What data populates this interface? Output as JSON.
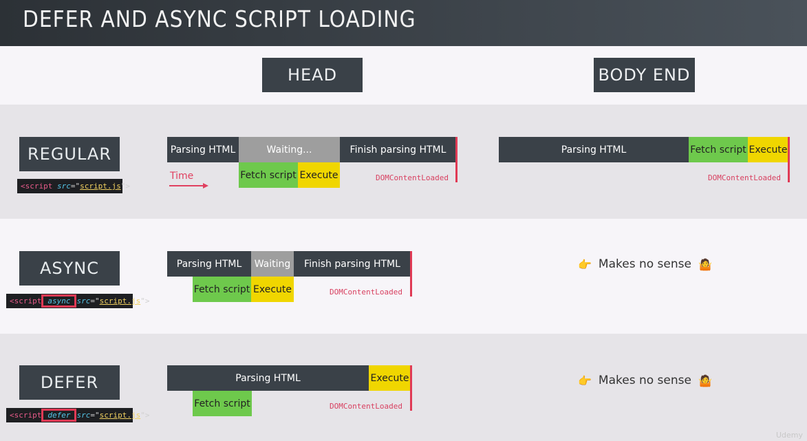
{
  "title": "DEFER AND ASYNC SCRIPT LOADING",
  "columns": {
    "head": "HEAD",
    "body_end": "BODY END"
  },
  "rows": {
    "regular": {
      "label": "REGULAR",
      "code": {
        "open": "<script ",
        "attr": "src",
        "eq": "=\"",
        "file": "script.js",
        "close": "\">"
      },
      "head": {
        "parse": "Parsing HTML",
        "wait": "Waiting...",
        "finish": "Finish parsing HTML",
        "fetch": "Fetch script",
        "exec": "Execute",
        "dcl": "DOMContentLoaded"
      },
      "time": "Time",
      "body": {
        "parse": "Parsing HTML",
        "fetch": "Fetch script",
        "exec": "Execute",
        "dcl": "DOMContentLoaded"
      }
    },
    "async": {
      "label": "ASYNC",
      "code": {
        "open": "<script",
        "kw": "async",
        "attr": "src",
        "eq": "=\"",
        "file": "script.js",
        "close": "\">"
      },
      "head": {
        "parse": "Parsing HTML",
        "wait": "Waiting",
        "finish": "Finish parsing HTML",
        "fetch": "Fetch script",
        "exec": "Execute",
        "dcl": "DOMContentLoaded"
      },
      "body": {
        "text": "Makes no sense",
        "pointer": "👉",
        "face": "🤷"
      }
    },
    "defer": {
      "label": "DEFER",
      "code": {
        "open": "<script",
        "kw": "defer",
        "attr": "src",
        "eq": "=\"",
        "file": "script.js",
        "close": "\">"
      },
      "head": {
        "parse": "Parsing HTML",
        "exec": "Execute",
        "fetch": "Fetch script",
        "dcl": "DOMContentLoaded"
      },
      "body": {
        "text": "Makes no sense",
        "pointer": "👉",
        "face": "🤷"
      }
    }
  },
  "watermark": "Udemy",
  "colors": {
    "dark": "#3a4148",
    "waiting": "#9e9e9e",
    "fetch": "#6ec94c",
    "execute": "#f0d600",
    "marker": "#e03a55"
  }
}
